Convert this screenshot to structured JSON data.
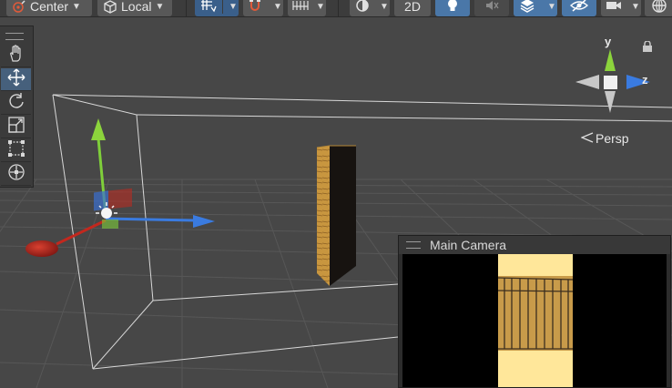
{
  "toolbar": {
    "pivot_label": "Center",
    "space_label": "Local",
    "toggle_2d_label": "2D",
    "icons": [
      "pivot-icon",
      "local-space-icon",
      "grid-snap-icon",
      "snap-increment-icon",
      "ruler-icon",
      "shading-mode-icon",
      "lighting-icon",
      "audio-icon",
      "effects-icon",
      "visibility-icon",
      "camera-icon",
      "gizmos-icon"
    ]
  },
  "tools": [
    {
      "name": "hand-tool",
      "icon": "hand-icon",
      "active": false
    },
    {
      "name": "move-tool",
      "icon": "move-icon",
      "active": true
    },
    {
      "name": "rotate-tool",
      "icon": "rotate-icon",
      "active": false
    },
    {
      "name": "scale-tool",
      "icon": "scale-icon",
      "active": false
    },
    {
      "name": "rect-tool",
      "icon": "rect-icon",
      "active": false
    },
    {
      "name": "transform-tool",
      "icon": "transform-icon",
      "active": false
    }
  ],
  "gizmo": {
    "y_label": "y",
    "z_label": "z",
    "projection_label": "Persp",
    "colors": {
      "y": "#8cd43c",
      "z": "#3a7be0",
      "x_inactive": "#c8c8c8"
    }
  },
  "camera_preview": {
    "title": "Main Camera"
  },
  "colors": {
    "scene_bg": "#474747",
    "selection_blue": "#46607c",
    "x_axis": "#c2281e",
    "y_axis": "#8cd43c",
    "z_axis": "#3a7be0",
    "wood": "#c89b4a"
  }
}
